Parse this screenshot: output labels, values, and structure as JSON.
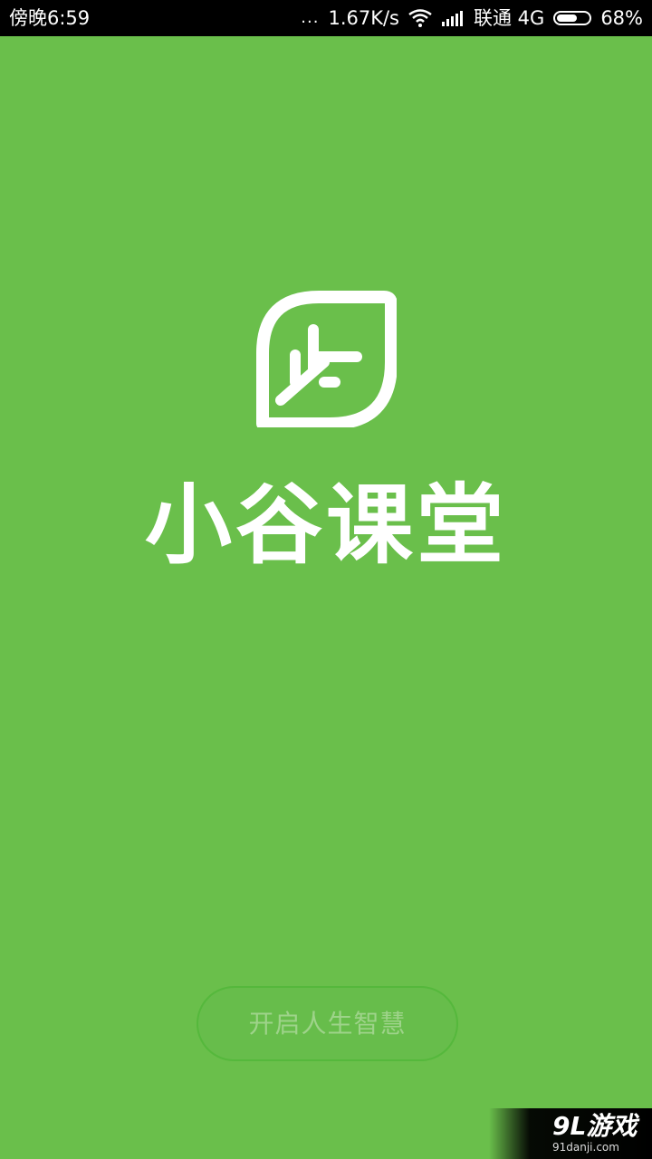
{
  "status_bar": {
    "time": "傍晚6:59",
    "dots": "...",
    "network_speed": "1.67K/s",
    "carrier": "联通 4G",
    "battery_percent": "68%",
    "battery_level": 0.68,
    "icons": [
      "wifi-icon",
      "signal-icon",
      "battery-icon"
    ]
  },
  "app": {
    "name": "小谷课堂",
    "logo_icon": "leaf-logo-icon",
    "accent_color": "#6abf4b"
  },
  "start_button": {
    "label": "开启人生智慧"
  },
  "watermark": {
    "text": "9L游戏",
    "site": "91danji.com"
  }
}
